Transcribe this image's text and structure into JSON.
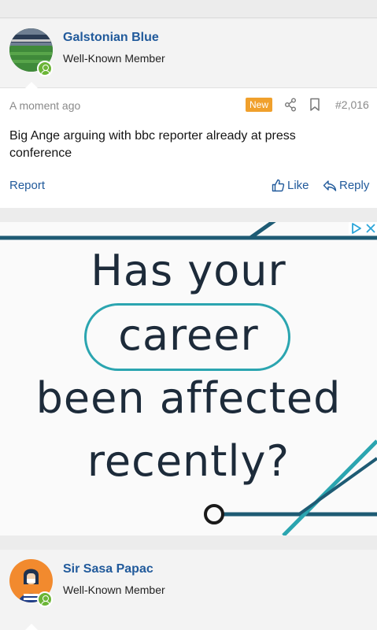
{
  "posts": [
    {
      "username": "Galstonian Blue",
      "user_title": "Well-Known Member",
      "timestamp": "A moment ago",
      "badge": "New",
      "post_number": "#2,016",
      "message": "Big Ange arguing with bbc reporter already at press conference",
      "report_label": "Report",
      "like_label": "Like",
      "reply_label": "Reply"
    },
    {
      "username": "Sir Sasa Papac",
      "user_title": "Well-Known Member"
    }
  ],
  "ad": {
    "line1": "Has your",
    "line2": "career",
    "line3": "been affected",
    "line4": "recently?"
  },
  "colors": {
    "link": "#215a9b",
    "badge_new": "#f0a02c",
    "online": "#6bb536",
    "ad_teal": "#2ba5b0",
    "ad_navy": "#1d2b3a"
  },
  "icons": [
    "share-icon",
    "bookmark-icon",
    "thumbs-up-icon",
    "reply-icon",
    "user-online-icon",
    "adchoices-icon",
    "close-icon"
  ]
}
